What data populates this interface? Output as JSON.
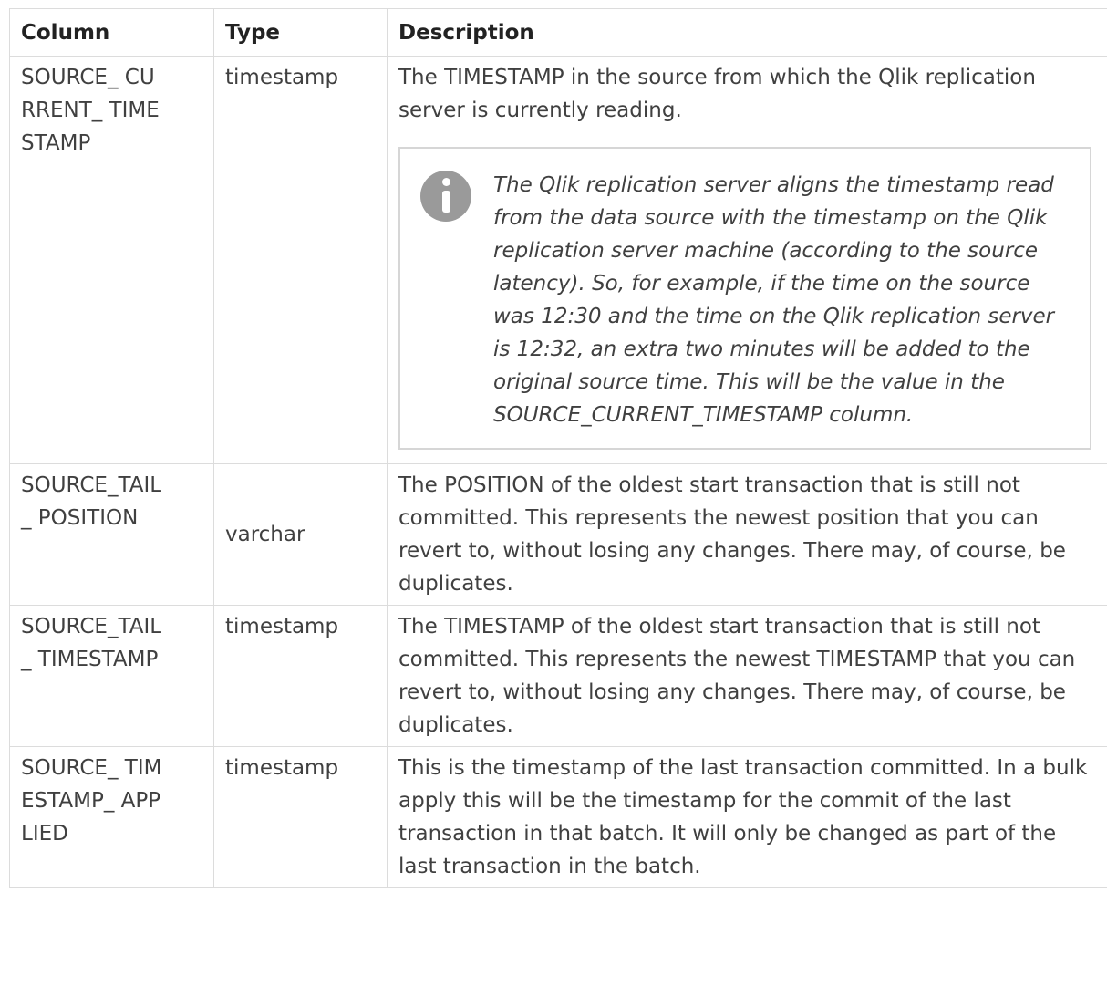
{
  "table": {
    "headers": [
      "Column",
      "Type",
      "Description"
    ],
    "rows": [
      {
        "column": "SOURCE_ CURRENT_ TIMESTAMP",
        "type": "timestamp",
        "description": "The TIMESTAMP in the source from which the Qlik replication server is currently reading.",
        "note": "The Qlik replication server aligns the timestamp read from the data source with the timestamp on the Qlik replication server machine (according to the source latency). So, for example, if the time on the source was 12:30 and the time on the Qlik replication server is 12:32, an extra two minutes will be added to the original source time. This will be the value in the SOURCE_CURRENT_TIMESTAMP column."
      },
      {
        "column": "SOURCE_TAIL_ POSITION",
        "type": "varchar",
        "description": "The POSITION of the oldest start transaction that is still not committed. This represents the newest position that you can revert to, without losing any changes. There may, of course, be duplicates."
      },
      {
        "column": "SOURCE_TAIL_ TIMESTAMP",
        "type": "timestamp",
        "description": "The TIMESTAMP of the oldest start transaction that is still not committed. This represents the newest TIMESTAMP that you can revert to, without losing any changes. There may, of course, be duplicates."
      },
      {
        "column": "SOURCE_ TIMESTAMP_ APPLIED",
        "type": "timestamp",
        "description": "This is the timestamp of the last transaction committed. In a bulk apply this will be the timestamp for the commit of the last transaction in that batch. It will only be changed as part of the last transaction in the batch."
      }
    ]
  },
  "icons": {
    "note_icon": "info-icon"
  },
  "colors": {
    "border": "#dcdcdc",
    "text": "#404040",
    "icon": "#9a9a9a"
  }
}
